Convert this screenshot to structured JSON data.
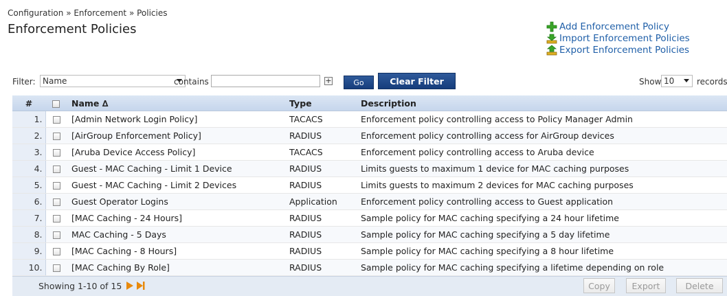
{
  "breadcrumb": "Configuration » Enforcement » Policies",
  "title": "Enforcement Policies",
  "actions": [
    {
      "label": "Add Enforcement Policy",
      "icon": "add-icon"
    },
    {
      "label": "Import Enforcement Policies",
      "icon": "import-icon"
    },
    {
      "label": "Export Enforcement Policies",
      "icon": "export-icon"
    }
  ],
  "filter": {
    "label": "Filter:",
    "field_value": "Name",
    "operator_label": "contains",
    "value": "",
    "go_label": "Go",
    "clear_label": "Clear Filter",
    "show_label": "Show",
    "records_value": "10",
    "records_label": "records"
  },
  "table": {
    "headers": {
      "num": "#",
      "name": "Name ∆",
      "type": "Type",
      "description": "Description"
    },
    "rows": [
      {
        "num": "1.",
        "name": "[Admin Network Login Policy]",
        "type": "TACACS",
        "description": "Enforcement policy controlling access to Policy Manager Admin"
      },
      {
        "num": "2.",
        "name": "[AirGroup Enforcement Policy]",
        "type": "RADIUS",
        "description": "Enforcement policy controlling access for AirGroup devices"
      },
      {
        "num": "3.",
        "name": "[Aruba Device Access Policy]",
        "type": "TACACS",
        "description": "Enforcement policy controlling access to Aruba device"
      },
      {
        "num": "4.",
        "name": "Guest - MAC Caching - Limit 1 Device",
        "type": "RADIUS",
        "description": "Limits guests to maximum 1 device for MAC caching purposes"
      },
      {
        "num": "5.",
        "name": "Guest - MAC Caching - Limit 2 Devices",
        "type": "RADIUS",
        "description": "Limits guests to maximum 2 devices for MAC caching purposes"
      },
      {
        "num": "6.",
        "name": "Guest Operator Logins",
        "type": "Application",
        "description": "Enforcement policy controlling access to Guest application"
      },
      {
        "num": "7.",
        "name": "[MAC Caching - 24 Hours]",
        "type": "RADIUS",
        "description": "Sample policy for MAC caching specifying a 24 hour lifetime"
      },
      {
        "num": "8.",
        "name": "MAC Caching - 5 Days",
        "type": "RADIUS",
        "description": "Sample policy for MAC caching specifying a 5 day lifetime"
      },
      {
        "num": "9.",
        "name": "[MAC Caching - 8 Hours]",
        "type": "RADIUS",
        "description": "Sample policy for MAC caching specifying a 8 hour lifetime"
      },
      {
        "num": "10.",
        "name": "[MAC Caching By Role]",
        "type": "RADIUS",
        "description": "Sample policy for MAC caching specifying a lifetime depending on role"
      }
    ]
  },
  "footer": {
    "showing": "Showing 1-10 of 15",
    "copy_label": "Copy",
    "export_label": "Export",
    "delete_label": "Delete"
  },
  "colors": {
    "link": "#1f5fa8",
    "header_bg": "#c6d6ec",
    "accent_orange": "#e8890c",
    "button_blue": "#163d7c"
  }
}
